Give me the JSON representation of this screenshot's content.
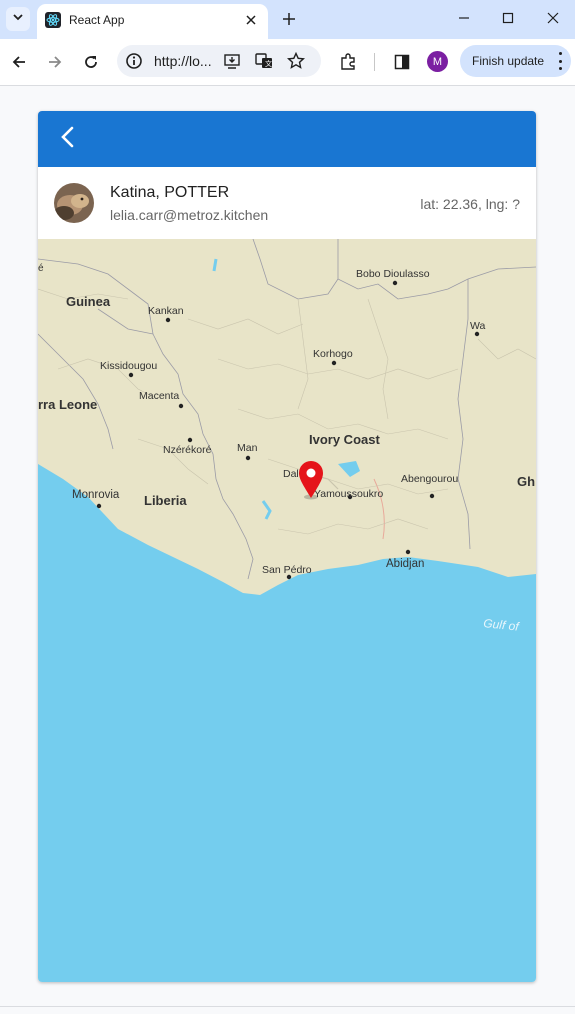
{
  "browser": {
    "tab_title": "React App",
    "url": "http://lo...",
    "profile_initial": "M",
    "finish_update_label": "Finish update"
  },
  "app": {
    "user_name": "Katina, POTTER",
    "user_email": "lelia.carr@metroz.kitchen",
    "coords": "lat: 22.36, lng: ?"
  },
  "map": {
    "places": {
      "guinea": "Guinea",
      "kankan": "Kankan",
      "kissidougou": "Kissidougou",
      "macenta": "Macenta",
      "sierra_leone": "rra Leone",
      "nzerekore": "Nzérékoré",
      "monrovia": "Monrovia",
      "liberia": "Liberia",
      "man": "Man",
      "ivory_coast": "Ivory Coast",
      "korhogo": "Korhogo",
      "bobo": "Bobo Dioulasso",
      "wa": "Wa",
      "daloa": "Dal",
      "yamoussoukro": "Yamoussoukro",
      "abengourou": "Abengourou",
      "abidjan": "Abidjan",
      "san_pedro": "San Pédro",
      "gulf": "Gulf of",
      "ghana": "Gh",
      "e_edge": "é"
    },
    "colors": {
      "land": "#e8e4c8",
      "water": "#74cdee",
      "marker": "#e5141a",
      "appbar": "#1976d2"
    }
  }
}
